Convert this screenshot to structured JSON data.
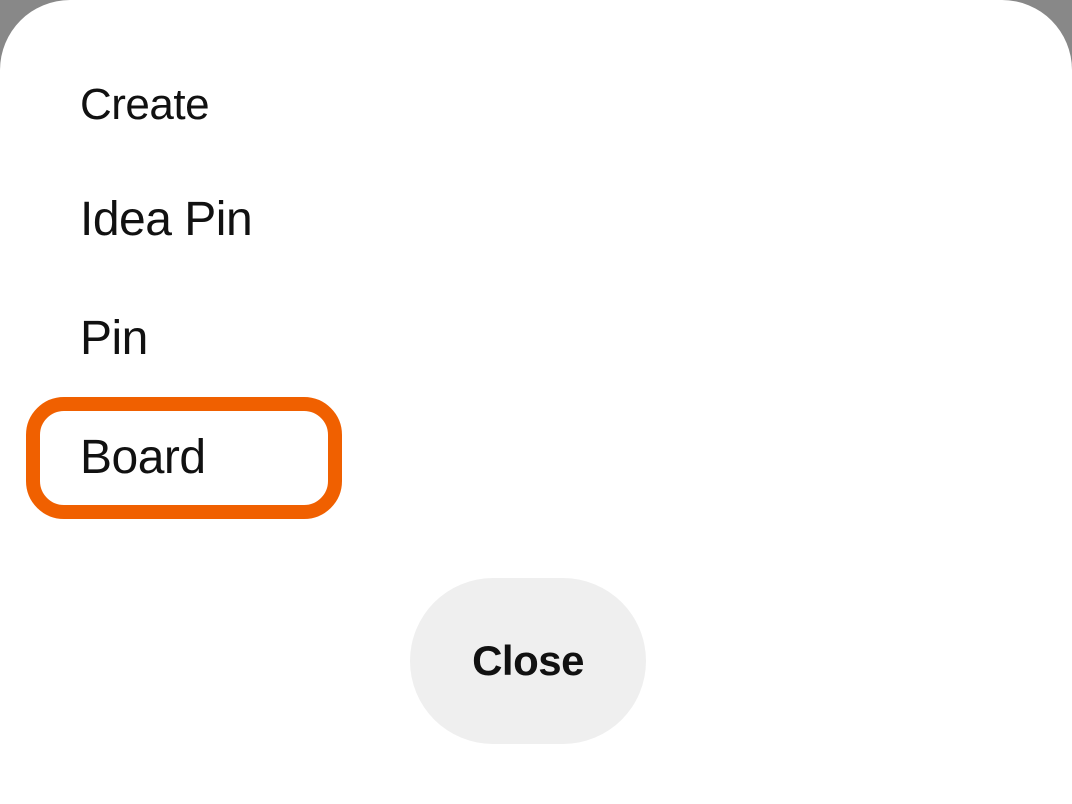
{
  "sheet": {
    "heading": "Create",
    "options": {
      "idea_pin": "Idea Pin",
      "pin": "Pin",
      "board": "Board"
    },
    "close_label": "Close"
  },
  "annotation": {
    "highlighted_option": "board",
    "highlight_color": "#f06000"
  }
}
